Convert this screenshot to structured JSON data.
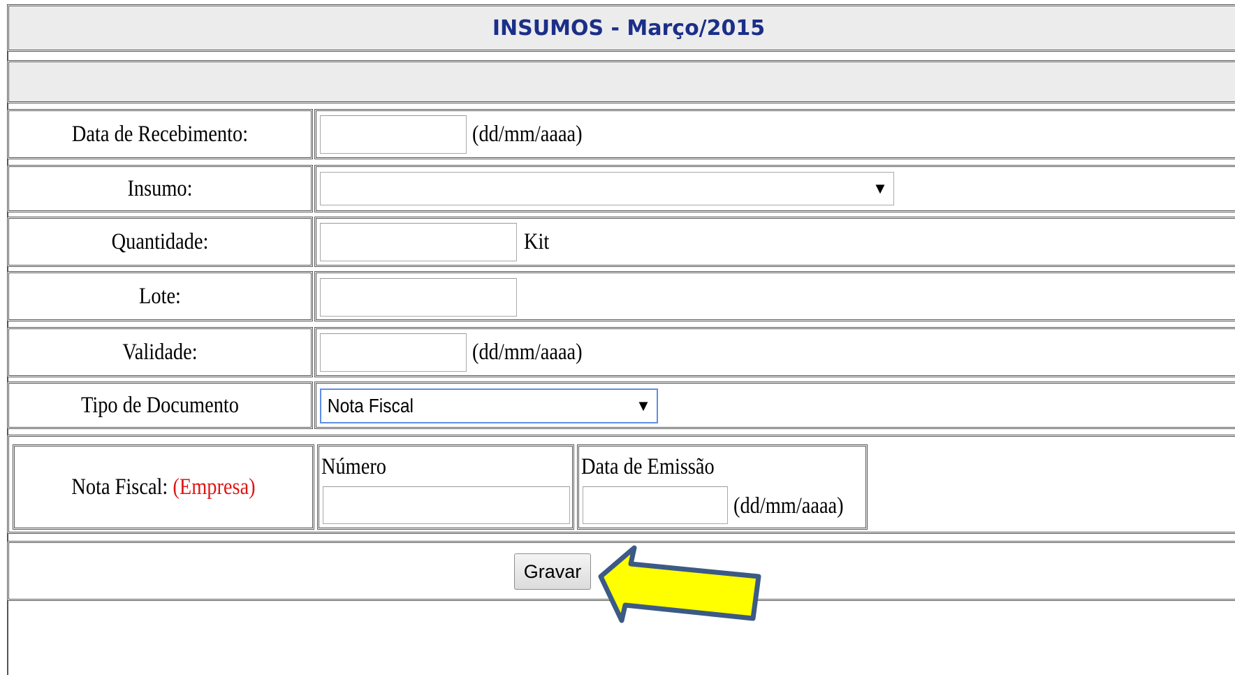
{
  "header": {
    "title": "INSUMOS - Março/2015"
  },
  "form": {
    "data_recebimento": {
      "label": "Data de Recebimento:",
      "value": "",
      "hint": "(dd/mm/aaaa)"
    },
    "insumo": {
      "label": "Insumo:",
      "selected": ""
    },
    "quantidade": {
      "label": "Quantidade:",
      "value": "",
      "unit": "Kit"
    },
    "lote": {
      "label": "Lote:",
      "value": ""
    },
    "validade": {
      "label": "Validade:",
      "value": "",
      "hint": "(dd/mm/aaaa)"
    },
    "tipo_documento": {
      "label": "Tipo de Documento",
      "selected": "Nota Fiscal"
    },
    "nota_fiscal": {
      "label": "Nota Fiscal:",
      "label_extra": "(Empresa)",
      "numero_label": "Número",
      "numero_value": "",
      "emissao_label": "Data de Emissão",
      "emissao_value": "",
      "emissao_hint": "(dd/mm/aaaa)"
    }
  },
  "actions": {
    "save_label": "Gravar"
  },
  "annotation": {
    "arrow_color": "#ffff00",
    "arrow_outline": "#3b5a86"
  }
}
